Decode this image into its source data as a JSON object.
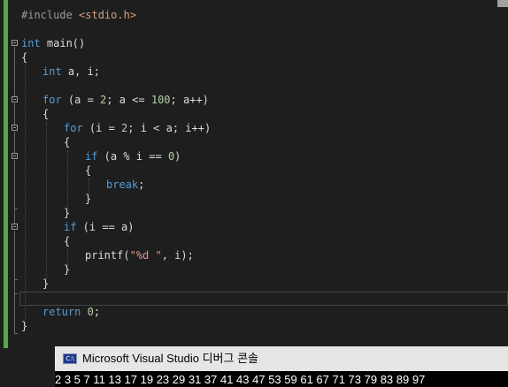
{
  "editor": {
    "lines": {
      "l1": {
        "directive": "#include",
        "header": "<stdio.h>"
      },
      "l3": {
        "type": "int",
        "name": " main()"
      },
      "l4": {
        "brace": "{"
      },
      "l5": {
        "type": "int",
        "rest": " a, i;"
      },
      "l7": {
        "kw": "for",
        "p1": " (a = ",
        "n1": "2",
        "p2": "; a <= ",
        "n2": "100",
        "p3": "; a++)"
      },
      "l8": {
        "brace": "{"
      },
      "l9": {
        "kw": "for",
        "p1": " (i = ",
        "n1": "2",
        "p2": "; i < a; i++)"
      },
      "l10": {
        "brace": "{"
      },
      "l11": {
        "kw": "if",
        "p1": " (a % i == ",
        "n1": "0",
        "p2": ")"
      },
      "l12": {
        "brace": "{"
      },
      "l13": {
        "kw": "break",
        "rest": ";"
      },
      "l14": {
        "brace": "}"
      },
      "l15": {
        "brace": "}"
      },
      "l16": {
        "kw": "if",
        "rest": " (i == a)"
      },
      "l17": {
        "brace": "{"
      },
      "l18": {
        "fn": "printf",
        "p1": "(",
        "str": "\"%d \"",
        "p2": ", i);"
      },
      "l19": {
        "brace": "}"
      },
      "l20": {
        "brace": "}"
      },
      "l22": {
        "kw": "return",
        "p1": " ",
        "n1": "0",
        "p2": ";"
      },
      "l23": {
        "brace": "}"
      }
    }
  },
  "console": {
    "icon_label": "C:\\",
    "title": "Microsoft Visual Studio 디버그 콘솔",
    "output": "2 3 5 7 11 13 17 19 23 29 31 37 41 43 47 53 59 61 67 71 73 79 83 89 97"
  }
}
